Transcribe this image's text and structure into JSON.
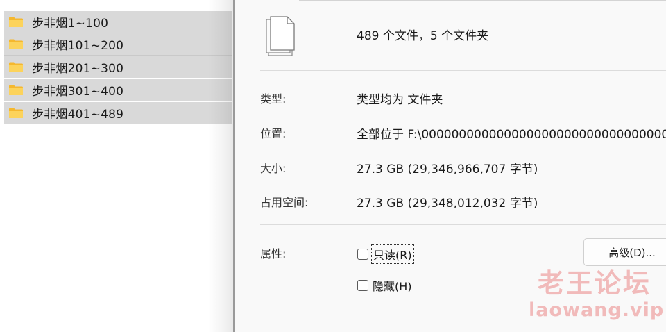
{
  "explorer": {
    "folders": [
      {
        "name": "步非烟1~100"
      },
      {
        "name": "步非烟101~200"
      },
      {
        "name": "步非烟201~300"
      },
      {
        "name": "步非烟301~400"
      },
      {
        "name": "步非烟401~489"
      }
    ],
    "folder_icon": "folder-icon",
    "folder_color": "#f8c53d"
  },
  "properties": {
    "summary": "489 个文件，5 个文件夹",
    "type": {
      "label": "类型:",
      "value": "类型均为 文件夹"
    },
    "location": {
      "label": "位置:",
      "value": "全部位于 F:\\000000000000000000000000000000000"
    },
    "size": {
      "label": "大小:",
      "value": "27.3 GB (29,346,966,707 字节)"
    },
    "size_on_disk": {
      "label": "占用空间:",
      "value": "27.3 GB (29,348,012,032 字节)"
    },
    "attributes": {
      "label": "属性:",
      "readonly": {
        "label": "只读(R)",
        "checked": false
      },
      "hidden": {
        "label": "隐藏(H)",
        "checked": false
      },
      "advanced_button": "高级(D)..."
    }
  },
  "watermark": {
    "line1": "老王论坛",
    "line2": "laowang.vip",
    "color": "#e86464"
  }
}
